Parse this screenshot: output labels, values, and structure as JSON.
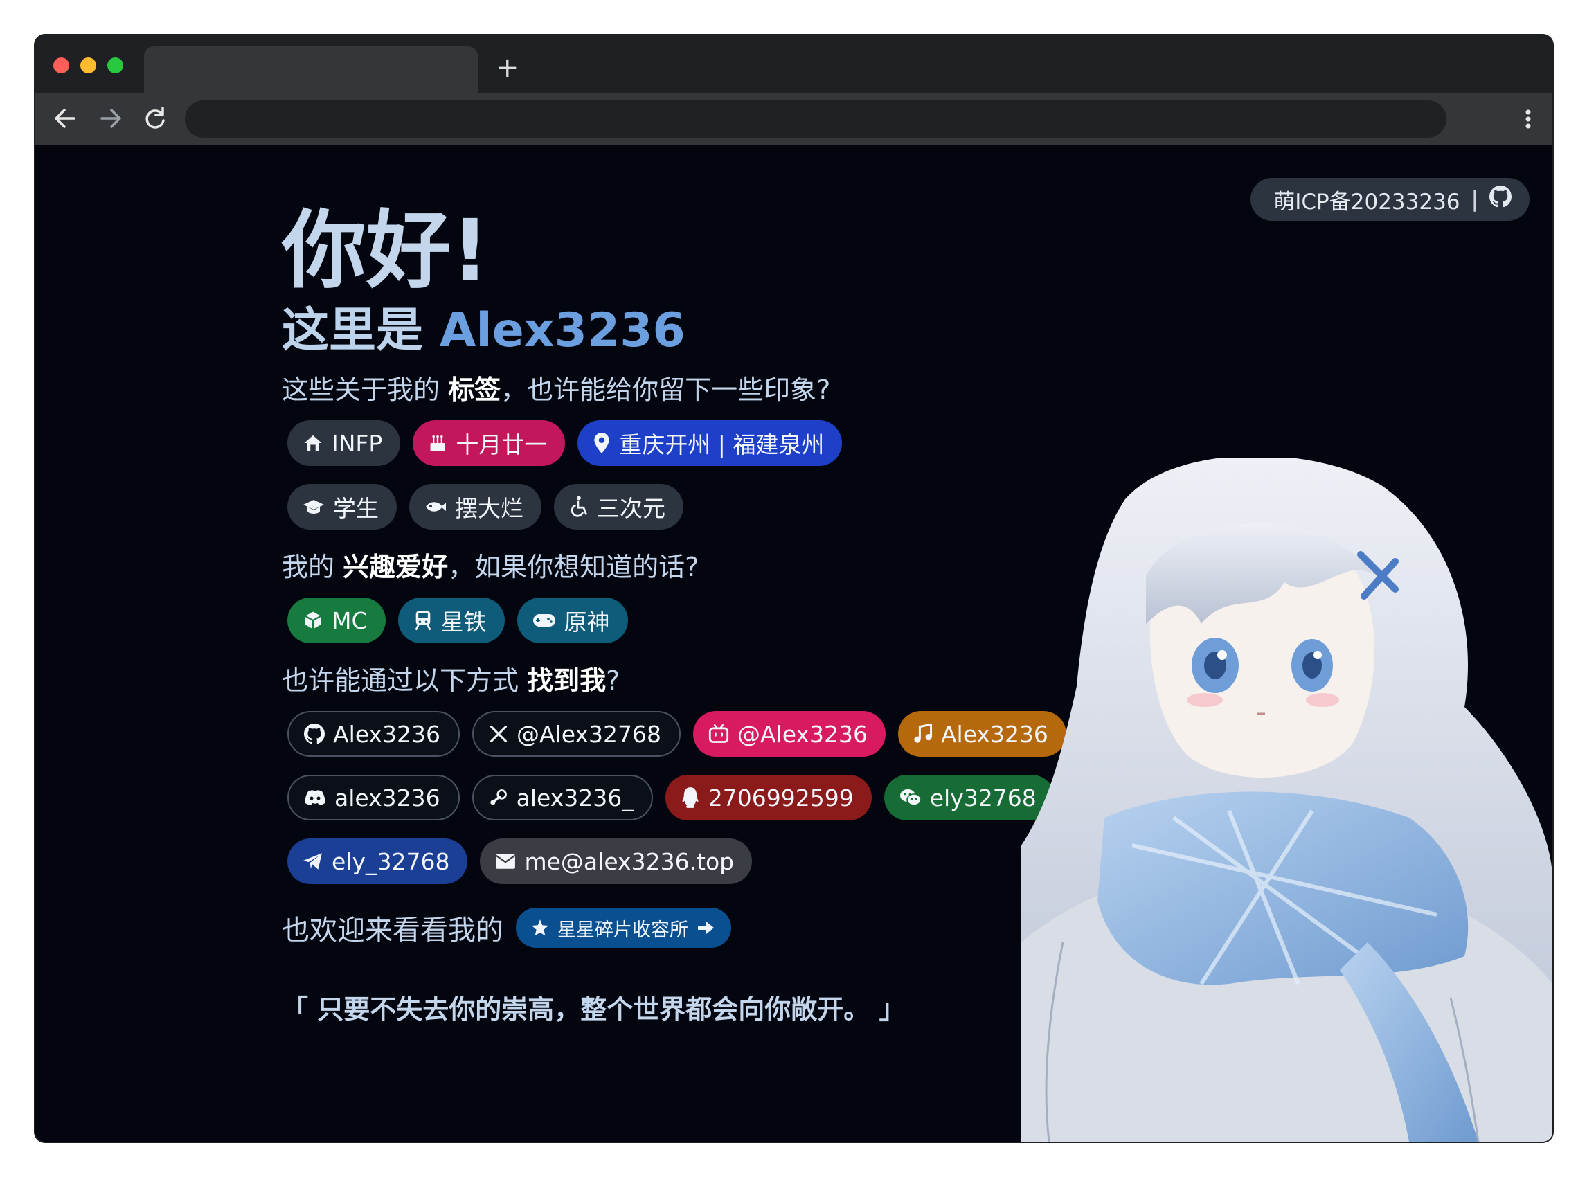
{
  "browser": {
    "new_tab_symbol": "+"
  },
  "icp": {
    "text": "萌ICP备20233236",
    "separator": "|"
  },
  "greeting": {
    "title": "你好!",
    "subtitle_prefix": "这里是 ",
    "subtitle_name": "Alex3236"
  },
  "tags_section": {
    "prefix": "这些关于我的 ",
    "bold": "标签",
    "suffix": "，也许能给你留下一些印象?"
  },
  "tags": [
    {
      "label": "INFP",
      "icon": "home-icon",
      "color": "#2c3440"
    },
    {
      "label": "十月廿一",
      "icon": "birthday-cake-icon",
      "color": "#c2185b"
    },
    {
      "label": "重庆开州 | 福建泉州",
      "icon": "location-pin-icon",
      "color": "#1e40c8"
    },
    {
      "label": "学生",
      "icon": "graduation-cap-icon",
      "color": "#2c3440"
    },
    {
      "label": "摆大烂",
      "icon": "fish-icon",
      "color": "#2c3440"
    },
    {
      "label": "三次元",
      "icon": "wheelchair-icon",
      "color": "#2c3440"
    }
  ],
  "hobbies_section": {
    "prefix": "我的 ",
    "bold": "兴趣爱好",
    "suffix": "，如果你想知道的话?"
  },
  "hobbies": [
    {
      "label": "MC",
      "icon": "cube-icon",
      "color": "#177a3e"
    },
    {
      "label": "星铁",
      "icon": "train-icon",
      "color": "#0e5c7a"
    },
    {
      "label": "原神",
      "icon": "gamepad-icon",
      "color": "#0e5c7a"
    }
  ],
  "contact_section": {
    "prefix": "也许能通过以下方式 ",
    "bold": "找到我",
    "suffix": "?"
  },
  "contacts": [
    {
      "label": "Alex3236",
      "icon": "github-icon",
      "color": "#0b0f18"
    },
    {
      "label": "@Alex32768",
      "icon": "x-twitter-icon",
      "color": "#0b0f18"
    },
    {
      "label": "@Alex3236",
      "icon": "bilibili-icon",
      "color": "#d81b60"
    },
    {
      "label": "Alex3236",
      "icon": "music-note-icon",
      "color": "#b5680c"
    },
    {
      "label": "alex3236",
      "icon": "discord-icon",
      "color": "#0b0f18"
    },
    {
      "label": "alex3236_",
      "icon": "steam-icon",
      "color": "#0b0f18"
    },
    {
      "label": "2706992599",
      "icon": "qq-icon",
      "color": "#8b1a1a"
    },
    {
      "label": "ely32768",
      "icon": "wechat-icon",
      "color": "#176b34"
    },
    {
      "label": "ely_32768",
      "icon": "telegram-icon",
      "color": "#1b3f95"
    },
    {
      "label": "me@alex3236.top",
      "icon": "envelope-icon",
      "color": "#3a3d44"
    }
  ],
  "visit": {
    "text": "也欢迎来看看我的",
    "button": "星星碎片收容所"
  },
  "quote": "「 只要不失去你的崇高，整个世界都会向你敞开。 」"
}
